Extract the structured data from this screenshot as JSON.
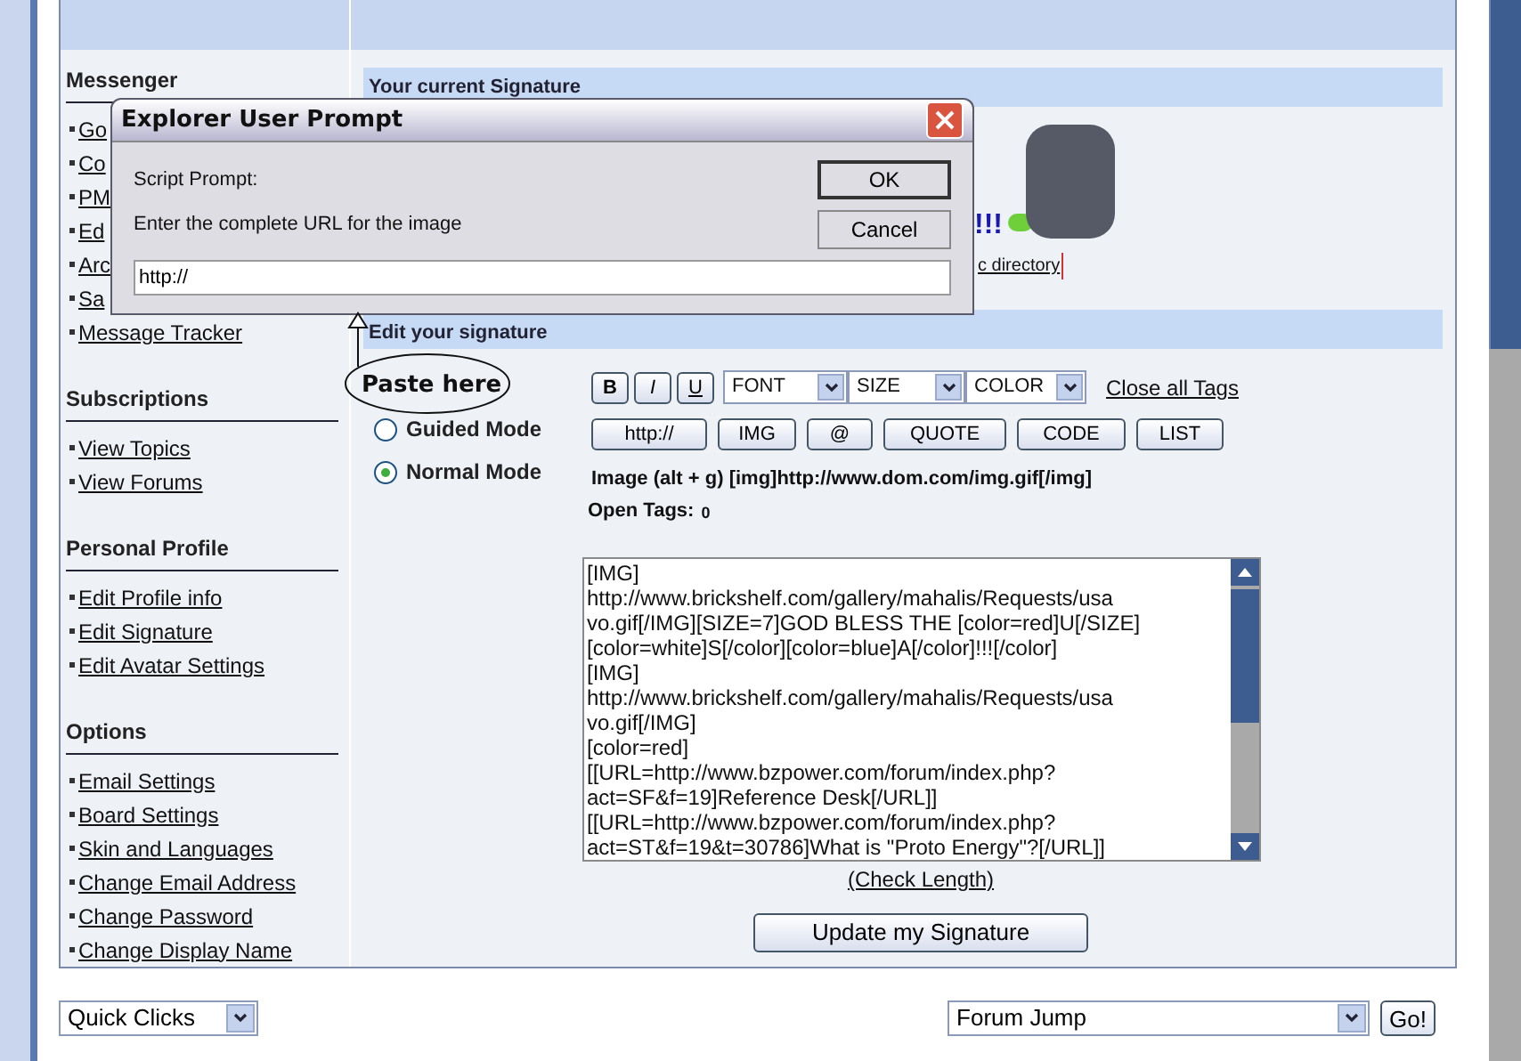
{
  "sidebar": {
    "sections": [
      {
        "title": "Messenger",
        "items": [
          "Go",
          "Co",
          "PM",
          "Ed",
          "Arc",
          "Sa",
          "Message Tracker"
        ]
      },
      {
        "title": "Subscriptions",
        "items": [
          "View Topics",
          "View Forums"
        ]
      },
      {
        "title": "Personal Profile",
        "items": [
          "Edit Profile info",
          "Edit Signature",
          "Edit Avatar Settings"
        ]
      },
      {
        "title": "Options",
        "items": [
          "Email Settings",
          "Board Settings",
          "Skin and Languages",
          "Change Email Address",
          "Change Password",
          "Change Display Name"
        ]
      }
    ]
  },
  "signature_preview": {
    "title": "Your current Signature",
    "text_fragment": "!!!",
    "link_fragment": "c directory"
  },
  "editor": {
    "title": "Edit your signature",
    "modes": [
      {
        "label": "Guided Mode",
        "selected": false
      },
      {
        "label": "Normal Mode",
        "selected": true
      }
    ],
    "format_buttons": [
      "B",
      "I",
      "U"
    ],
    "dropdowns": [
      "FONT",
      "SIZE",
      "COLOR"
    ],
    "close_tags": "Close all Tags",
    "tag_buttons": [
      "http://",
      "IMG",
      "@",
      "QUOTE",
      "CODE",
      "LIST"
    ],
    "hint": "Image (alt + g) [img]http://www.dom.com/img.gif[/img]",
    "open_tags_label": "Open Tags:",
    "open_tags_count": "0",
    "signature_lines": [
      "[IMG]",
      "http://www.brickshelf.com/gallery/mahalis/Requests/usa",
      "vo.gif[/IMG][SIZE=7]GOD BLESS THE [color=red]U[/SIZE]",
      "[color=white]S[/color][color=blue]A[/color]!!![/color]",
      "[IMG]",
      "http://www.brickshelf.com/gallery/mahalis/Requests/usa",
      "vo.gif[/IMG]",
      "[color=red]",
      "[[URL=http://www.bzpower.com/forum/index.php?",
      "act=SF&f=19]Reference Desk[/URL]]",
      "[[URL=http://www.bzpower.com/forum/index.php?",
      "act=ST&f=19&t=30786]What is \"Proto Energy\"?[/URL]]"
    ],
    "check_length": "(Check Length)",
    "submit": "Update my Signature"
  },
  "footer": {
    "quick_clicks": "Quick Clicks",
    "forum_jump": "Forum Jump",
    "go": "Go!"
  },
  "dialog": {
    "title": "Explorer User Prompt",
    "label": "Script Prompt:",
    "message": "Enter the complete URL for the image",
    "value": "http://",
    "buttons": [
      "OK",
      "Cancel"
    ]
  },
  "callout": {
    "text": "Paste here"
  }
}
